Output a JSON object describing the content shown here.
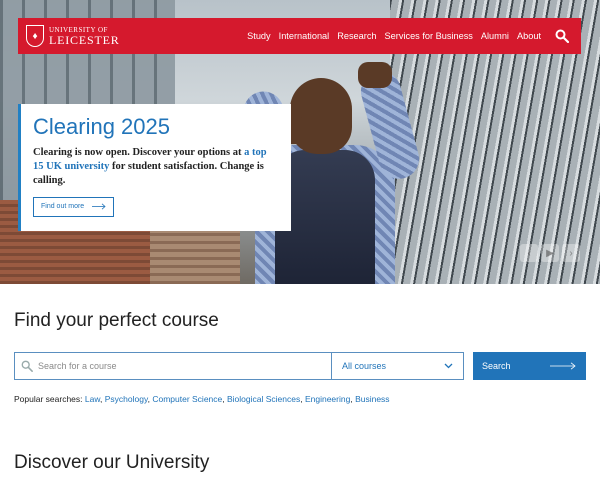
{
  "brand": {
    "logo_top": "UNIVERSITY OF",
    "logo_main": "LEICESTER",
    "accent": "#d5192d",
    "link_color": "#2174b9"
  },
  "nav": {
    "items": [
      {
        "label": "Study"
      },
      {
        "label": "International"
      },
      {
        "label": "Research"
      },
      {
        "label": "Services for Business"
      },
      {
        "label": "Alumni"
      },
      {
        "label": "About"
      }
    ],
    "search_icon": "search-icon"
  },
  "hero": {
    "title": "Clearing 2025",
    "body_before": "Clearing is now open. Discover your options at ",
    "body_link": "a top 15 UK university",
    "body_after": " for student satisfaction. Change is calling.",
    "button_label": "Find out more",
    "carousel_icons": [
      "chevron-left-icon",
      "play-icon",
      "chevron-right-icon"
    ]
  },
  "course_finder": {
    "heading": "Find your perfect course",
    "search_placeholder": "Search for a course",
    "select_value": "All courses",
    "search_button": "Search",
    "popular_label": "Popular searches:",
    "popular": [
      "Law",
      "Psychology",
      "Computer Science",
      "Biological Sciences",
      "Engineering",
      "Business"
    ]
  },
  "discover": {
    "heading": "Discover our University"
  }
}
